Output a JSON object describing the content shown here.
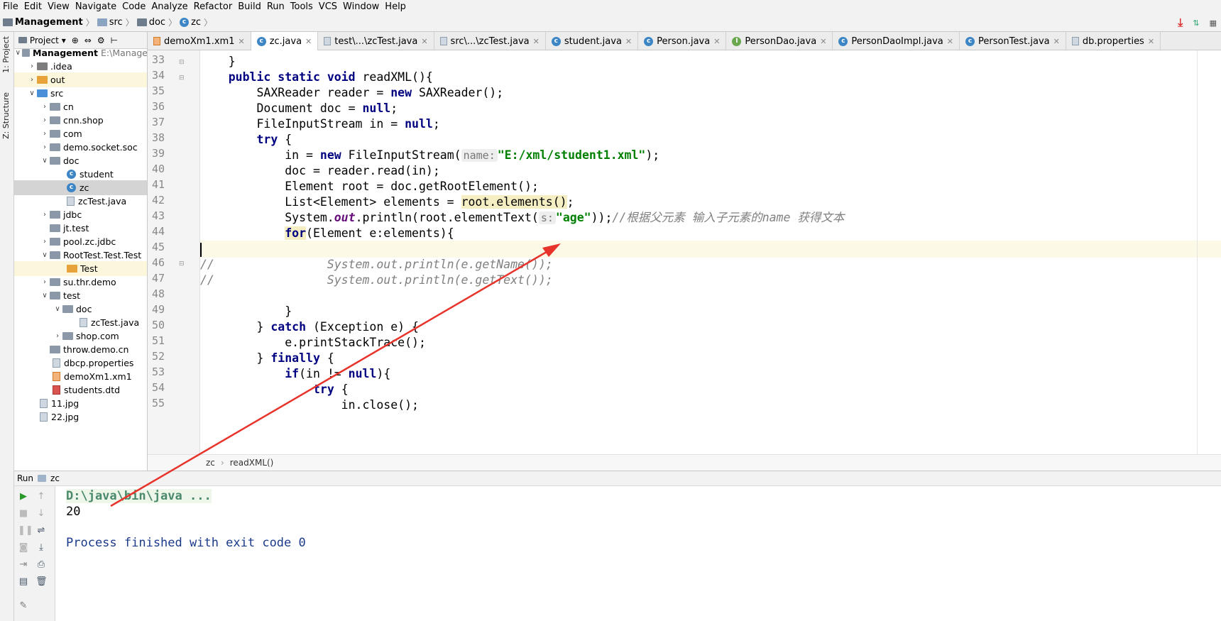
{
  "menu": [
    "File",
    "Edit",
    "View",
    "Navigate",
    "Code",
    "Analyze",
    "Refactor",
    "Build",
    "Run",
    "Tools",
    "VCS",
    "Window",
    "Help"
  ],
  "breadcrumb": {
    "project": "Management",
    "items": [
      "src",
      "doc",
      "zc"
    ]
  },
  "left_tabs": {
    "project": "1: Project",
    "structure": "Z: Structure"
  },
  "project_panel": {
    "title": "Project",
    "root": {
      "name": "Management",
      "path": "E:\\Manage"
    },
    "items": [
      {
        "label": ".idea",
        "kind": "idea"
      },
      {
        "label": "out",
        "kind": "out"
      },
      {
        "label": "src",
        "kind": "src"
      },
      {
        "label": "cn",
        "kind": "pkg"
      },
      {
        "label": "cnn.shop",
        "kind": "pkg"
      },
      {
        "label": "com",
        "kind": "pkg"
      },
      {
        "label": "demo.socket.soc",
        "kind": "pkg"
      },
      {
        "label": "doc",
        "kind": "pkg"
      },
      {
        "label": "student",
        "kind": "class"
      },
      {
        "label": "zc",
        "kind": "class"
      },
      {
        "label": "zcTest.java",
        "kind": "file"
      },
      {
        "label": "jdbc",
        "kind": "pkg"
      },
      {
        "label": "jt.test",
        "kind": "pkg"
      },
      {
        "label": "pool.zc.jdbc",
        "kind": "pkg"
      },
      {
        "label": "RootTest.Test.Test",
        "kind": "pkg"
      },
      {
        "label": "Test",
        "kind": "out"
      },
      {
        "label": "su.thr.demo",
        "kind": "pkg"
      },
      {
        "label": "test",
        "kind": "pkg"
      },
      {
        "label": "doc",
        "kind": "pkg"
      },
      {
        "label": "zcTest.java",
        "kind": "file"
      },
      {
        "label": "shop.com",
        "kind": "pkg"
      },
      {
        "label": "throw.demo.cn",
        "kind": "pkg"
      },
      {
        "label": "dbcp.properties",
        "kind": "file"
      },
      {
        "label": "demoXm1.xm1",
        "kind": "xml"
      },
      {
        "label": "students.dtd",
        "kind": "dtd"
      },
      {
        "label": "11.jpg",
        "kind": "file"
      },
      {
        "label": "22.jpg",
        "kind": "file"
      }
    ]
  },
  "tabs": [
    {
      "label": "demoXm1.xm1",
      "icon": "xml-icon"
    },
    {
      "label": "zc.java",
      "icon": "class-icon",
      "active": true
    },
    {
      "label": "test\\...\\zcTest.java",
      "icon": "file-icon"
    },
    {
      "label": "src\\...\\zcTest.java",
      "icon": "file-icon"
    },
    {
      "label": "student.java",
      "icon": "class-icon"
    },
    {
      "label": "Person.java",
      "icon": "class-icon"
    },
    {
      "label": "PersonDao.java",
      "icon": "interface-icon"
    },
    {
      "label": "PersonDaoImpl.java",
      "icon": "class-icon"
    },
    {
      "label": "PersonTest.java",
      "icon": "class-icon"
    },
    {
      "label": "db.properties",
      "icon": "file-icon"
    }
  ],
  "line_numbers": [
    "33",
    "34",
    "35",
    "36",
    "37",
    "38",
    "39",
    "40",
    "41",
    "42",
    "43",
    "44",
    "45",
    "46",
    "47",
    "48",
    "49",
    "50",
    "51",
    "52",
    "53",
    "54",
    "55"
  ],
  "code": {
    "l33a": "    }",
    "l34a": "    ",
    "l34kw1": "public static void",
    "l34b": " readXML(){",
    "l35a": "        SAXReader reader = ",
    "l35kw": "new",
    "l35b": " SAXReader();",
    "l36a": "        Document doc = ",
    "l36null": "null",
    "l36b": ";",
    "l37a": "        FileInputStream in = ",
    "l37null": "null",
    "l37b": ";",
    "l38a": "        ",
    "l38kw": "try",
    "l38b": " {",
    "l39a": "            in = ",
    "l39kw": "new",
    "l39b": " FileInputStream(",
    "l39hint": "name:",
    "l39str": "\"E:/xml/student1.xml\"",
    "l39c": ");",
    "l40a": "            doc = reader.read(in);",
    "l41a": "            Element root = doc.getRootElement();",
    "l42a": "            List<Element> elements = ",
    "l42mk": "root.elements()",
    "l42b": ";",
    "l43a": "            System.",
    "l43field": "out",
    "l43b": ".println(root.elementText(",
    "l43hint": "s:",
    "l43str": "\"age\"",
    "l43c": "));",
    "l43cm": "//根据父元素 输入子元素的name 获得文本",
    "l44a": "            ",
    "l44kw": "for",
    "l44b": "(Element e:elements){",
    "l45a": "",
    "l46cm": "//                System.out.println(e.getName());",
    "l47cm": "//                System.out.println(e.getText());",
    "l48a": "",
    "l49a": "            }",
    "l50a": "        } ",
    "l50kw": "catch",
    "l50b": " (Exception e) {",
    "l51a": "            e.printStackTrace();",
    "l52a": "        } ",
    "l52kw": "finally",
    "l52b": " {",
    "l53a": "            ",
    "l53kw": "if",
    "l53b": "(in != ",
    "l53null": "null",
    "l53c": "){",
    "l54a": "                ",
    "l54kw": "try",
    "l54b": " {",
    "l55a": "                    in.close();"
  },
  "code_crumb": [
    "zc",
    "readXML()"
  ],
  "run_panel": {
    "label": "Run",
    "config": "zc"
  },
  "console": {
    "cmd": "D:\\java\\bin\\java ...",
    "output": "20",
    "finished": "Process finished with exit code 0"
  },
  "colors": {
    "keyword": "#000080",
    "string": "#008000",
    "comment": "#808080",
    "annotation_arrow": "#e8332a"
  }
}
